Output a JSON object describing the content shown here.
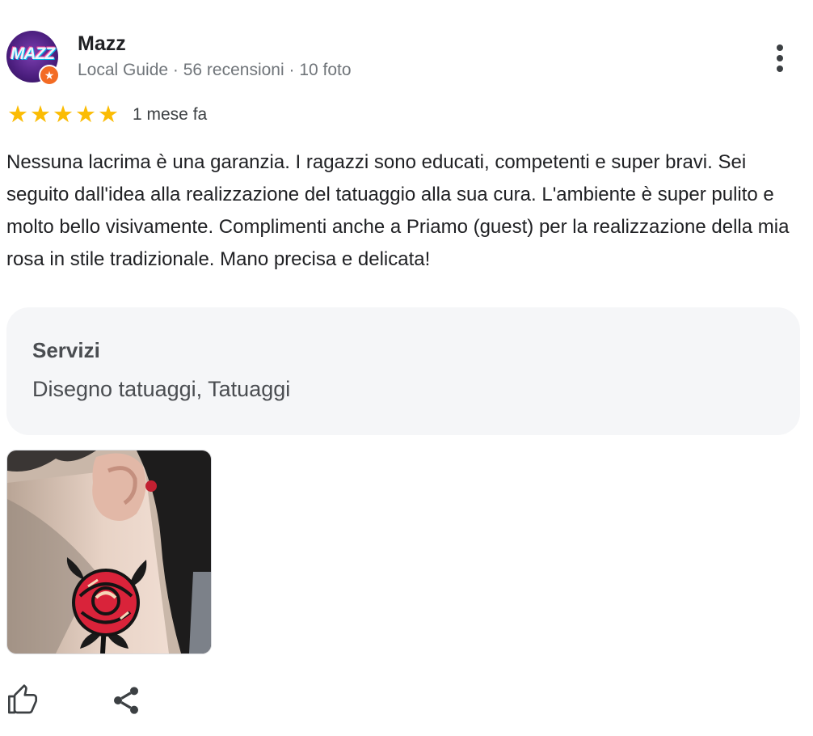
{
  "reviewer": {
    "name": "Mazz",
    "avatar_logo_text": "MAZZ",
    "badge_icon": "star",
    "meta": "Local Guide · 56 recensioni · 10 foto"
  },
  "review": {
    "rating": 5,
    "rating_max": 5,
    "time_ago": "1 mese fa",
    "text": "Nessuna lacrima è una garanzia. I ragazzi sono educati, competenti e super bravi. Sei seguito dall'idea alla realizzazione del tatuaggio alla sua cura. L'ambiente è super pulito e molto bello visivamente. Complimenti anche a Priamo (guest) per la realizzazione della mia rosa in stile tradizionale. Mano precisa e delicata!"
  },
  "services": {
    "title": "Servizi",
    "value": "Disegno tatuaggi, Tatuaggi"
  },
  "actions": {
    "like_icon": "thumb-up-icon",
    "share_icon": "share-icon",
    "menu_icon": "more-vert-icon"
  },
  "colors": {
    "star": "#fbbc04",
    "badge": "#f36b23",
    "services_bg": "#f5f6f8",
    "secondary_text": "#70757a"
  }
}
